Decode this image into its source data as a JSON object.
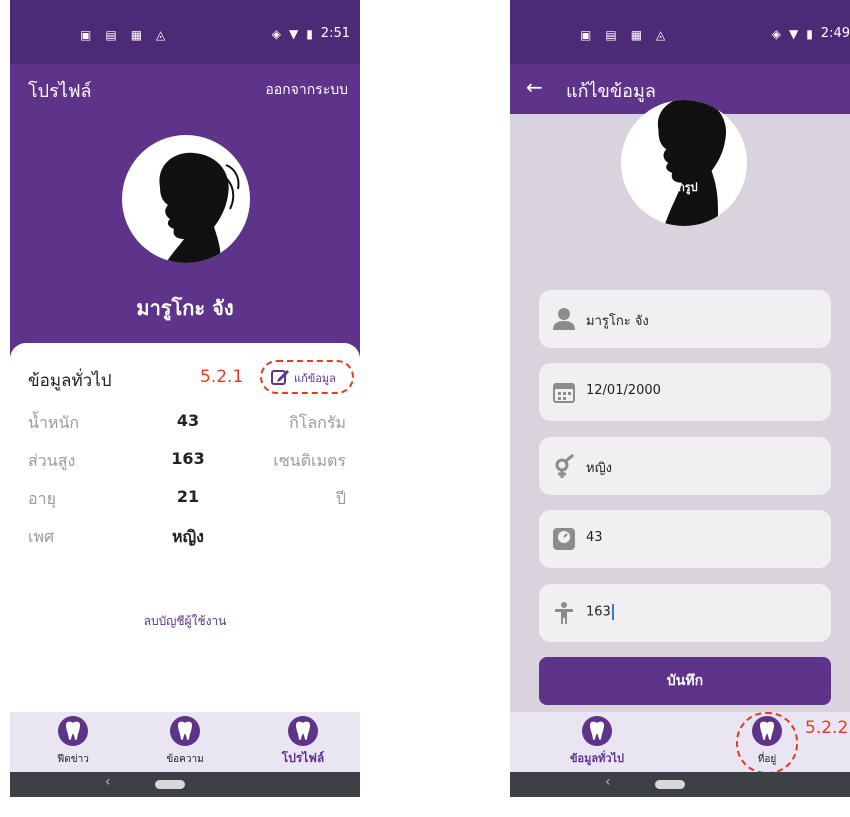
{
  "left_screen": {
    "status": {
      "time": "2:51"
    },
    "app_bar": {
      "title": "โปรไฟล์",
      "action": "ออกจากระบบ"
    },
    "profile": {
      "name": "มารูโกะ จัง"
    },
    "card": {
      "title": "ข้อมูลทั่วไป",
      "annotation": "5.2.1",
      "edit_label": "แก้ข้อมูล",
      "rows": [
        {
          "label": "น้ำหนัก",
          "value": "43",
          "unit": "กิโลกรัม"
        },
        {
          "label": "ส่วนสูง",
          "value": "163",
          "unit": "เซนติเมตร"
        },
        {
          "label": "อายุ",
          "value": "21",
          "unit": "ปี"
        },
        {
          "label": "เพศ",
          "value": "หญิง",
          "unit": ""
        }
      ]
    },
    "delete_account": "ลบบัญชีผู้ใช้งาน",
    "nav": [
      {
        "label": "ฟีดข่าว"
      },
      {
        "label": "ข้อความ"
      },
      {
        "label": "โปรไฟล์"
      }
    ],
    "sys_back": "‹"
  },
  "right_screen": {
    "status": {
      "time": "2:49"
    },
    "app_bar": {
      "back": "←",
      "title": "แก้ไขข้อมูล"
    },
    "avatar": {
      "choose_photo": "เลือกรูป"
    },
    "fields": [
      {
        "icon": "person-icon",
        "value": "มารูโกะ จัง"
      },
      {
        "icon": "calendar-icon",
        "value": "12/01/2000"
      },
      {
        "icon": "gender-icon",
        "value": "หญิง"
      },
      {
        "icon": "scale-icon",
        "value": "43"
      },
      {
        "icon": "height-icon",
        "value": "163"
      }
    ],
    "save_label": "บันทึก",
    "nav": [
      {
        "label": "ข้อมูลทั่วไป"
      },
      {
        "label": "ที่อยู่"
      }
    ],
    "annotation": "5.2.2",
    "sys_back": "‹"
  },
  "colors": {
    "primary": "#5d348a",
    "status_bar": "#4d2a75",
    "nav_background": "#eae5f2",
    "annotation": "#e63b1e"
  }
}
